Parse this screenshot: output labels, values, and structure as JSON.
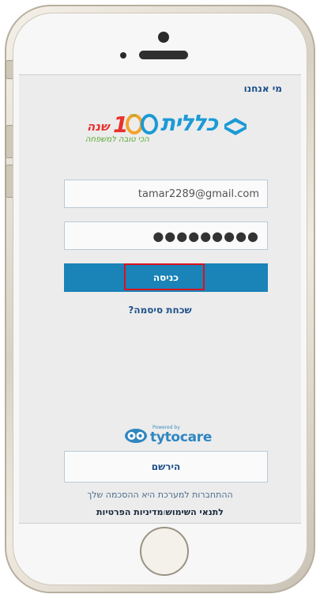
{
  "header": {
    "about_link": "מי אנחנו"
  },
  "logo": {
    "brand": "כללית",
    "hundred": "100",
    "hundred_small": "שנה",
    "shana": "שנה",
    "tagline": "הכי טובה למשפחה"
  },
  "login": {
    "email_value": "tamar2289@gmail.com",
    "password_value": "●●●●●●●●●",
    "login_label": "כניסה",
    "forgot_label": "שכחת סיסמה?"
  },
  "partner": {
    "powered_by": "Powered by",
    "name": "tytocare"
  },
  "register": {
    "label": "הירשם"
  },
  "footer": {
    "consent_text": "ההתחברות למערכת היא ההסכמה שלך",
    "terms_link": "לתנאי השימוש",
    "and": "ו",
    "privacy_link": "מדיניות הפרטיות"
  },
  "colors": {
    "primary_button": "#1a83b8",
    "link": "#1c4f8a",
    "highlight": "#d9121f"
  }
}
